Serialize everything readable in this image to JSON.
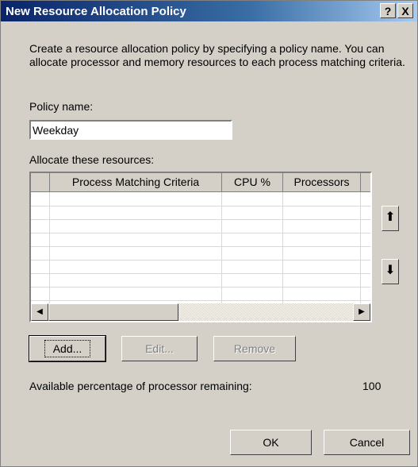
{
  "window": {
    "title": "New Resource Allocation Policy",
    "help_button": "?",
    "close_button": "X"
  },
  "intro_text": "Create a resource allocation policy by specifying a policy name. You can allocate processor and memory resources to each process matching criteria.",
  "policy_name": {
    "label": "Policy name:",
    "value": "Weekday"
  },
  "resources": {
    "label": "Allocate these resources:",
    "columns": [
      "Process Matching Criteria",
      "CPU %",
      "Processors"
    ],
    "rows": []
  },
  "buttons": {
    "add": "Add...",
    "edit": "Edit...",
    "remove": "Remove",
    "ok": "OK",
    "cancel": "Cancel"
  },
  "available": {
    "label": "Available percentage of processor remaining:",
    "value": "100"
  },
  "icons": {
    "move_up": "up-arrow-icon",
    "move_down": "down-arrow-icon"
  }
}
